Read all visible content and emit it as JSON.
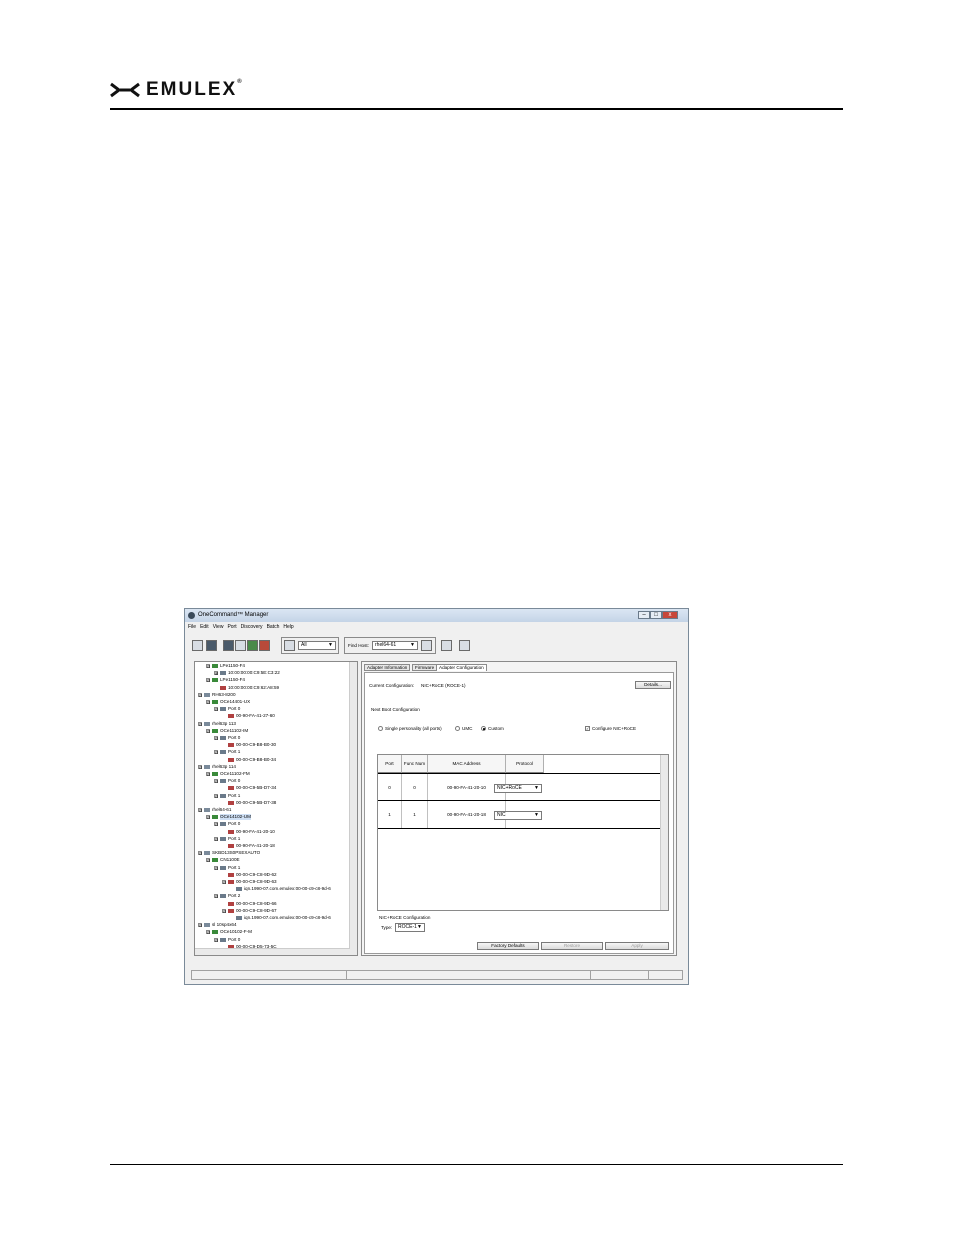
{
  "brand": {
    "name": "EMULEX",
    "trademark": "®"
  },
  "app": {
    "title": "OneCommand™ Manager",
    "window_buttons": [
      "–",
      "□",
      "x"
    ]
  },
  "menu": [
    "File",
    "Edit",
    "View",
    "Port",
    "Discovery",
    "Batch",
    "Help"
  ],
  "toolbar": {
    "filter_value": "All",
    "find_host_label": "Find Host:",
    "find_host_value": "rhel64-61"
  },
  "tree": [
    {
      "level": 1,
      "type": "card",
      "text": "LPe1150-F4",
      "expander": "⊟"
    },
    {
      "level": 2,
      "type": "port",
      "text": "10:00:00:00:C9:5E:C3:22",
      "expander": "⊞"
    },
    {
      "level": 1,
      "type": "card",
      "text": "LPe1150-F4",
      "expander": "⊟"
    },
    {
      "level": 2,
      "type": "mac",
      "text": "10:00:00:00:C9:62:A8:59",
      "expander": ""
    },
    {
      "level": 0,
      "type": "srv",
      "text": "RH63-8200",
      "expander": "⊟"
    },
    {
      "level": 1,
      "type": "card",
      "text": "OCe14401-UX",
      "expander": "⊟"
    },
    {
      "level": 2,
      "type": "port",
      "text": "Port 0",
      "expander": "⊟"
    },
    {
      "level": 3,
      "type": "mac",
      "text": "00-90-FA-41-27-60",
      "expander": ""
    },
    {
      "level": 0,
      "type": "srv",
      "text": "rhel63p 113",
      "expander": "⊟"
    },
    {
      "level": 1,
      "type": "card",
      "text": "OCe11102-IM",
      "expander": "⊟"
    },
    {
      "level": 2,
      "type": "port",
      "text": "Port 0",
      "expander": "⊟"
    },
    {
      "level": 3,
      "type": "mac",
      "text": "00-00-C9-B8-B0-30",
      "expander": ""
    },
    {
      "level": 2,
      "type": "port",
      "text": "Port 1",
      "expander": "⊟"
    },
    {
      "level": 3,
      "type": "mac",
      "text": "00-00-C9-B8-B0-34",
      "expander": ""
    },
    {
      "level": 0,
      "type": "srv",
      "text": "rhel63p 114",
      "expander": "⊟"
    },
    {
      "level": 1,
      "type": "card",
      "text": "OCe11102-FM",
      "expander": "⊟"
    },
    {
      "level": 2,
      "type": "port",
      "text": "Port 0",
      "expander": "⊟"
    },
    {
      "level": 3,
      "type": "mac",
      "text": "00-00-C9-5B-D7-34",
      "expander": ""
    },
    {
      "level": 2,
      "type": "port",
      "text": "Port 1",
      "expander": "⊟"
    },
    {
      "level": 3,
      "type": "mac",
      "text": "00-00-C9-5B-D7-38",
      "expander": ""
    },
    {
      "level": 0,
      "type": "srv",
      "text": "rhel64-61",
      "expander": "⊟"
    },
    {
      "level": 1,
      "type": "card",
      "text": "OCe14102-UM",
      "expander": "⊟",
      "highlight": true
    },
    {
      "level": 2,
      "type": "port",
      "text": "Port 0",
      "expander": "⊟"
    },
    {
      "level": 3,
      "type": "mac",
      "text": "00-90-FA-41-20-10",
      "expander": ""
    },
    {
      "level": 2,
      "type": "port",
      "text": "Port 1",
      "expander": "⊟"
    },
    {
      "level": 3,
      "type": "mac",
      "text": "00-90-FA-41-20-18",
      "expander": ""
    },
    {
      "level": 0,
      "type": "srv",
      "text": "SKBD13S0PSEXAUTO",
      "expander": "⊟"
    },
    {
      "level": 1,
      "type": "card",
      "text": "CN1100E",
      "expander": "⊟"
    },
    {
      "level": 2,
      "type": "port",
      "text": "Port 1",
      "expander": "⊟"
    },
    {
      "level": 3,
      "type": "mac",
      "text": "00-00-C9-C8-9D-62",
      "expander": ""
    },
    {
      "level": 3,
      "type": "mac",
      "text": "00-00-C9-C8-9D-63",
      "expander": "⊟"
    },
    {
      "level": 4,
      "type": "port",
      "text": "iqn.1990-07.com.emulex:00-00-c9-c8-9d-6",
      "expander": ""
    },
    {
      "level": 2,
      "type": "port",
      "text": "Port 2",
      "expander": "⊟"
    },
    {
      "level": 3,
      "type": "mac",
      "text": "00-00-C9-C8-9D-66",
      "expander": ""
    },
    {
      "level": 3,
      "type": "mac",
      "text": "00-00-C9-C8-9D-67",
      "expander": "⊟"
    },
    {
      "level": 4,
      "type": "port",
      "text": "iqn.1990-07.com.emulex:00-00-c9-c8-9d-6",
      "expander": ""
    },
    {
      "level": 0,
      "type": "srv",
      "text": "sl 10sp4x64",
      "expander": "⊟"
    },
    {
      "level": 1,
      "type": "card",
      "text": "OCe10102-F-M",
      "expander": "⊟"
    },
    {
      "level": 2,
      "type": "port",
      "text": "Port 0",
      "expander": "⊟"
    },
    {
      "level": 3,
      "type": "mac",
      "text": "00-00-C9-D5-73-5C",
      "expander": ""
    }
  ],
  "tabs": [
    "Adapter Information",
    "Firmware",
    "Adapter Configuration"
  ],
  "config": {
    "current_label": "Current Configuration:",
    "current_value": "NIC+RoCE (ROCE-1)",
    "details_button": "Details...",
    "next_boot_label": "Next Boot Configuration",
    "radio_single": "Single personality (all ports)",
    "radio_umc": "UMC",
    "radio_custom": "Custom",
    "selected_radio": "Custom",
    "configure_checkbox": "Configure NIC+RoCE",
    "configure_checked": true,
    "columns": [
      "Port",
      "Func Num",
      "MAC Address",
      "Protocol"
    ],
    "rows": [
      {
        "port": "0",
        "func": "0",
        "mac": "00-90-FA-41-20-10",
        "protocol": "NIC+RoCE"
      },
      {
        "port": "1",
        "func": "1",
        "mac": "00-90-FA-41-20-18",
        "protocol": "NIC"
      }
    ],
    "roce_group_label": "NIC+RoCE Configuration",
    "type_label": "Type:",
    "type_value": "ROCE-1",
    "factory_defaults_button": "Factory Defaults",
    "restore_button": "Restore",
    "apply_button": "Apply"
  }
}
